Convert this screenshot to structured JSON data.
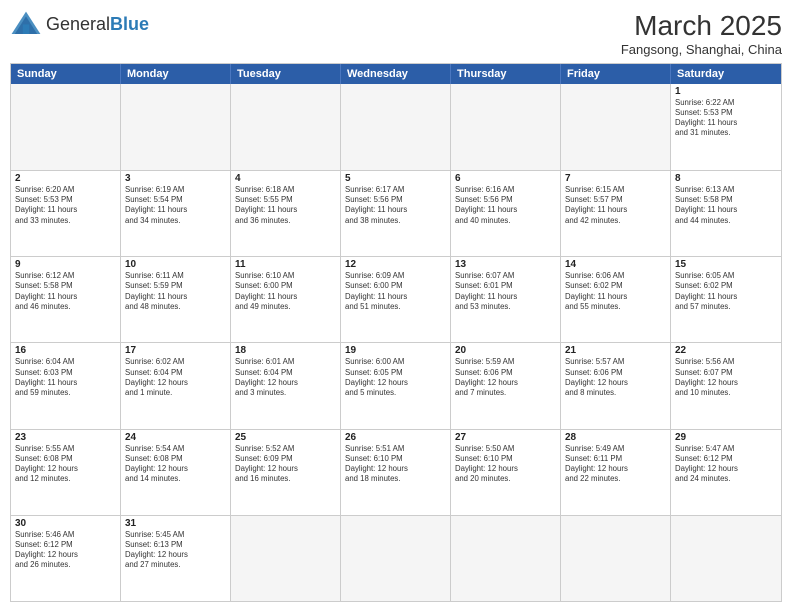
{
  "header": {
    "logo_general": "General",
    "logo_blue": "Blue",
    "month_year": "March 2025",
    "location": "Fangsong, Shanghai, China"
  },
  "days": {
    "headers": [
      "Sunday",
      "Monday",
      "Tuesday",
      "Wednesday",
      "Thursday",
      "Friday",
      "Saturday"
    ]
  },
  "weeks": [
    [
      {
        "num": "",
        "info": "",
        "empty": true
      },
      {
        "num": "",
        "info": "",
        "empty": true
      },
      {
        "num": "",
        "info": "",
        "empty": true
      },
      {
        "num": "",
        "info": "",
        "empty": true
      },
      {
        "num": "",
        "info": "",
        "empty": true
      },
      {
        "num": "",
        "info": "",
        "empty": true
      },
      {
        "num": "1",
        "info": "Sunrise: 6:22 AM\nSunset: 5:53 PM\nDaylight: 11 hours\nand 31 minutes.",
        "empty": false
      }
    ],
    [
      {
        "num": "2",
        "info": "Sunrise: 6:20 AM\nSunset: 5:53 PM\nDaylight: 11 hours\nand 33 minutes.",
        "empty": false
      },
      {
        "num": "3",
        "info": "Sunrise: 6:19 AM\nSunset: 5:54 PM\nDaylight: 11 hours\nand 34 minutes.",
        "empty": false
      },
      {
        "num": "4",
        "info": "Sunrise: 6:18 AM\nSunset: 5:55 PM\nDaylight: 11 hours\nand 36 minutes.",
        "empty": false
      },
      {
        "num": "5",
        "info": "Sunrise: 6:17 AM\nSunset: 5:56 PM\nDaylight: 11 hours\nand 38 minutes.",
        "empty": false
      },
      {
        "num": "6",
        "info": "Sunrise: 6:16 AM\nSunset: 5:56 PM\nDaylight: 11 hours\nand 40 minutes.",
        "empty": false
      },
      {
        "num": "7",
        "info": "Sunrise: 6:15 AM\nSunset: 5:57 PM\nDaylight: 11 hours\nand 42 minutes.",
        "empty": false
      },
      {
        "num": "8",
        "info": "Sunrise: 6:13 AM\nSunset: 5:58 PM\nDaylight: 11 hours\nand 44 minutes.",
        "empty": false
      }
    ],
    [
      {
        "num": "9",
        "info": "Sunrise: 6:12 AM\nSunset: 5:58 PM\nDaylight: 11 hours\nand 46 minutes.",
        "empty": false
      },
      {
        "num": "10",
        "info": "Sunrise: 6:11 AM\nSunset: 5:59 PM\nDaylight: 11 hours\nand 48 minutes.",
        "empty": false
      },
      {
        "num": "11",
        "info": "Sunrise: 6:10 AM\nSunset: 6:00 PM\nDaylight: 11 hours\nand 49 minutes.",
        "empty": false
      },
      {
        "num": "12",
        "info": "Sunrise: 6:09 AM\nSunset: 6:00 PM\nDaylight: 11 hours\nand 51 minutes.",
        "empty": false
      },
      {
        "num": "13",
        "info": "Sunrise: 6:07 AM\nSunset: 6:01 PM\nDaylight: 11 hours\nand 53 minutes.",
        "empty": false
      },
      {
        "num": "14",
        "info": "Sunrise: 6:06 AM\nSunset: 6:02 PM\nDaylight: 11 hours\nand 55 minutes.",
        "empty": false
      },
      {
        "num": "15",
        "info": "Sunrise: 6:05 AM\nSunset: 6:02 PM\nDaylight: 11 hours\nand 57 minutes.",
        "empty": false
      }
    ],
    [
      {
        "num": "16",
        "info": "Sunrise: 6:04 AM\nSunset: 6:03 PM\nDaylight: 11 hours\nand 59 minutes.",
        "empty": false
      },
      {
        "num": "17",
        "info": "Sunrise: 6:02 AM\nSunset: 6:04 PM\nDaylight: 12 hours\nand 1 minute.",
        "empty": false
      },
      {
        "num": "18",
        "info": "Sunrise: 6:01 AM\nSunset: 6:04 PM\nDaylight: 12 hours\nand 3 minutes.",
        "empty": false
      },
      {
        "num": "19",
        "info": "Sunrise: 6:00 AM\nSunset: 6:05 PM\nDaylight: 12 hours\nand 5 minutes.",
        "empty": false
      },
      {
        "num": "20",
        "info": "Sunrise: 5:59 AM\nSunset: 6:06 PM\nDaylight: 12 hours\nand 7 minutes.",
        "empty": false
      },
      {
        "num": "21",
        "info": "Sunrise: 5:57 AM\nSunset: 6:06 PM\nDaylight: 12 hours\nand 8 minutes.",
        "empty": false
      },
      {
        "num": "22",
        "info": "Sunrise: 5:56 AM\nSunset: 6:07 PM\nDaylight: 12 hours\nand 10 minutes.",
        "empty": false
      }
    ],
    [
      {
        "num": "23",
        "info": "Sunrise: 5:55 AM\nSunset: 6:08 PM\nDaylight: 12 hours\nand 12 minutes.",
        "empty": false
      },
      {
        "num": "24",
        "info": "Sunrise: 5:54 AM\nSunset: 6:08 PM\nDaylight: 12 hours\nand 14 minutes.",
        "empty": false
      },
      {
        "num": "25",
        "info": "Sunrise: 5:52 AM\nSunset: 6:09 PM\nDaylight: 12 hours\nand 16 minutes.",
        "empty": false
      },
      {
        "num": "26",
        "info": "Sunrise: 5:51 AM\nSunset: 6:10 PM\nDaylight: 12 hours\nand 18 minutes.",
        "empty": false
      },
      {
        "num": "27",
        "info": "Sunrise: 5:50 AM\nSunset: 6:10 PM\nDaylight: 12 hours\nand 20 minutes.",
        "empty": false
      },
      {
        "num": "28",
        "info": "Sunrise: 5:49 AM\nSunset: 6:11 PM\nDaylight: 12 hours\nand 22 minutes.",
        "empty": false
      },
      {
        "num": "29",
        "info": "Sunrise: 5:47 AM\nSunset: 6:12 PM\nDaylight: 12 hours\nand 24 minutes.",
        "empty": false
      }
    ],
    [
      {
        "num": "30",
        "info": "Sunrise: 5:46 AM\nSunset: 6:12 PM\nDaylight: 12 hours\nand 26 minutes.",
        "empty": false
      },
      {
        "num": "31",
        "info": "Sunrise: 5:45 AM\nSunset: 6:13 PM\nDaylight: 12 hours\nand 27 minutes.",
        "empty": false
      },
      {
        "num": "",
        "info": "",
        "empty": true
      },
      {
        "num": "",
        "info": "",
        "empty": true
      },
      {
        "num": "",
        "info": "",
        "empty": true
      },
      {
        "num": "",
        "info": "",
        "empty": true
      },
      {
        "num": "",
        "info": "",
        "empty": true
      }
    ]
  ]
}
